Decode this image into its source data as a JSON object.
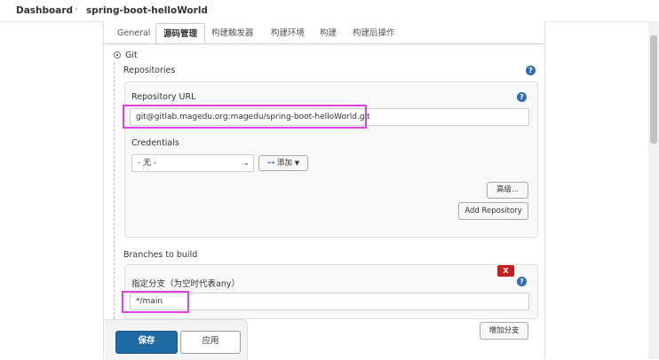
{
  "breadcrumb": {
    "dashboard": "Dashboard",
    "job": "spring-boot-helloWorld",
    "sep": "›"
  },
  "tabs": [
    {
      "label": "General"
    },
    {
      "label": "源码管理"
    },
    {
      "label": "构建触发器"
    },
    {
      "label": "构建环境"
    },
    {
      "label": "构建"
    },
    {
      "label": "构建后操作"
    }
  ],
  "scm": {
    "option_label": "Git",
    "repositories_label": "Repositories",
    "repo_url_label": "Repository URL",
    "repo_url_value": "git@gitlab.magedu.org:magedu/spring-boot-helloWorld.git",
    "credentials_label": "Credentials",
    "credentials_value": "- 无 -",
    "add_label": "添加",
    "advanced_label": "高级...",
    "add_repository_label": "Add Repository",
    "help_symbol": "?"
  },
  "branches": {
    "section_label": "Branches to build",
    "branch_label": "指定分支（为空时代表any）",
    "branch_value": "*/main",
    "delete_symbol": "X",
    "add_branch_label": "增加分支"
  },
  "footer": {
    "save_label": "保存",
    "apply_label": "应用"
  }
}
